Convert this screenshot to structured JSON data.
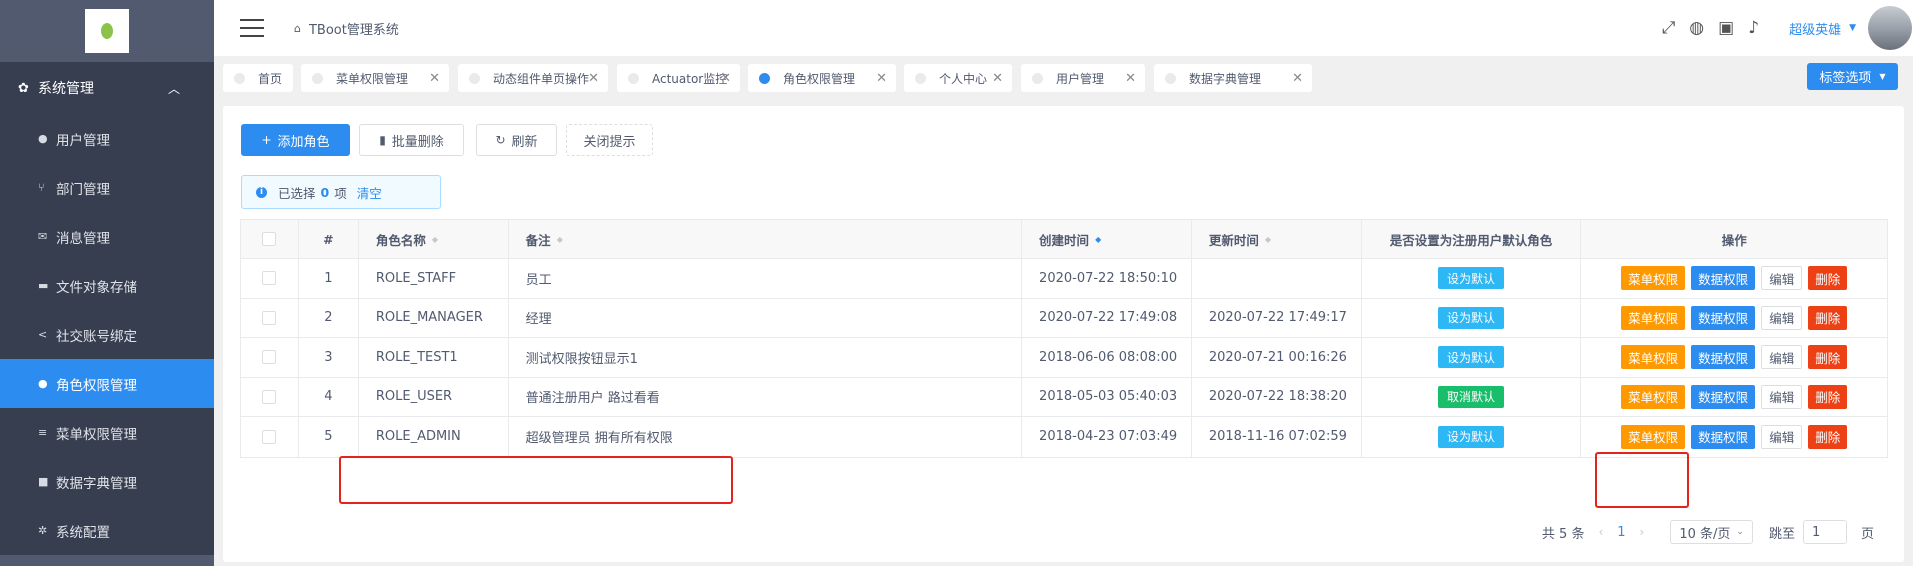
{
  "sidebar": {
    "group": {
      "label": "系统管理",
      "icon": "gear-icon"
    },
    "items": [
      {
        "label": "用户管理",
        "icon": "user-icon",
        "active": false
      },
      {
        "label": "部门管理",
        "icon": "branch-icon",
        "active": false
      },
      {
        "label": "消息管理",
        "icon": "envelope-icon",
        "active": false
      },
      {
        "label": "文件对象存储",
        "icon": "folder-icon",
        "active": false
      },
      {
        "label": "社交账号绑定",
        "icon": "share-icon",
        "active": false
      },
      {
        "label": "角色权限管理",
        "icon": "user-group-icon",
        "active": true
      },
      {
        "label": "菜单权限管理",
        "icon": "list-icon",
        "active": false
      },
      {
        "label": "数据字典管理",
        "icon": "book-icon",
        "active": false
      },
      {
        "label": "系统配置",
        "icon": "settings-icon",
        "active": false
      }
    ]
  },
  "header": {
    "breadcrumb": "TBoot管理系统",
    "username": "超级英雄"
  },
  "tabs": [
    {
      "label": "首页",
      "active": false,
      "closable": false
    },
    {
      "label": "菜单权限管理",
      "active": false,
      "closable": true
    },
    {
      "label": "动态组件单页操作",
      "active": false,
      "closable": true
    },
    {
      "label": "Actuator监控",
      "active": false,
      "closable": true
    },
    {
      "label": "角色权限管理",
      "active": true,
      "closable": true
    },
    {
      "label": "个人中心",
      "active": false,
      "closable": true
    },
    {
      "label": "用户管理",
      "active": false,
      "closable": true
    },
    {
      "label": "数据字典管理",
      "active": false,
      "closable": true
    }
  ],
  "tag_options": "标签选项",
  "toolbar": {
    "add_role": "添加角色",
    "batch_delete": "批量删除",
    "refresh": "刷新",
    "close_tips": "关闭提示"
  },
  "alert": {
    "prefix": "已选择",
    "count": "0",
    "suffix": "项",
    "clear": "清空"
  },
  "table": {
    "headers": {
      "index": "#",
      "role_name": "角色名称",
      "remark": "备注",
      "created": "创建时间",
      "updated": "更新时间",
      "default_role": "是否设置为注册用户默认角色",
      "actions": "操作"
    },
    "rows": [
      {
        "index": "1",
        "name": "ROLE_STAFF",
        "remark": "员工",
        "created": "2020-07-22 18:50:10",
        "updated": "",
        "default_label": "设为默认",
        "default_color": "#2db7f5"
      },
      {
        "index": "2",
        "name": "ROLE_MANAGER",
        "remark": "经理",
        "created": "2020-07-22 17:49:08",
        "updated": "2020-07-22 17:49:17",
        "default_label": "设为默认",
        "default_color": "#2db7f5"
      },
      {
        "index": "3",
        "name": "ROLE_TEST1",
        "remark": "测试权限按钮显示1",
        "created": "2018-06-06 08:08:00",
        "updated": "2020-07-21 00:16:26",
        "default_label": "设为默认",
        "default_color": "#2db7f5"
      },
      {
        "index": "4",
        "name": "ROLE_USER",
        "remark": "普通注册用户 路过看看",
        "created": "2018-05-03 05:40:03",
        "updated": "2020-07-22 18:38:20",
        "default_label": "取消默认",
        "default_color": "#19be6b"
      },
      {
        "index": "5",
        "name": "ROLE_ADMIN",
        "remark": "超级管理员 拥有所有权限",
        "created": "2018-04-23 07:03:49",
        "updated": "2018-11-16 07:02:59",
        "default_label": "设为默认",
        "default_color": "#2db7f5"
      }
    ],
    "actions": {
      "menu_perm": "菜单权限",
      "data_perm": "数据权限",
      "edit": "编辑",
      "delete": "删除"
    }
  },
  "pagination": {
    "total": "共 5 条",
    "current": "1",
    "page_size": "10 条/页",
    "jump_prefix": "跳至",
    "jump_value": "1",
    "jump_suffix": "页"
  },
  "colors": {
    "sidebar": "#515a6e",
    "sidebar_dark": "#363e4f",
    "primary": "#2d8cf0",
    "annotation": "#e6231a"
  }
}
